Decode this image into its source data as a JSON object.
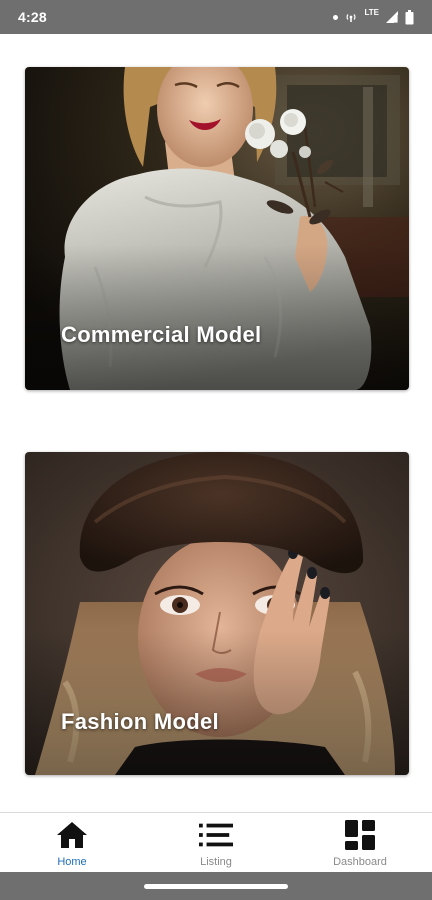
{
  "status_bar": {
    "time": "4:28",
    "network_label": "LTE",
    "icons": [
      "notification-dot-icon",
      "hotspot-icon",
      "signal-icon",
      "battery-icon"
    ]
  },
  "cards": [
    {
      "title": "Commercial Model",
      "image": "commercial-model-photo"
    },
    {
      "title": "Fashion Model",
      "image": "fashion-model-photo"
    }
  ],
  "bottom_nav": {
    "active": "Home",
    "items": [
      {
        "label": "Home",
        "icon": "home-icon"
      },
      {
        "label": "Listing",
        "icon": "list-icon"
      },
      {
        "label": "Dashboard",
        "icon": "dashboard-icon"
      }
    ]
  },
  "colors": {
    "status_bar": "#6f6f6f",
    "active_nav": "#1f6fb5",
    "inactive_nav": "#8a8a8a",
    "icon": "#111111"
  }
}
